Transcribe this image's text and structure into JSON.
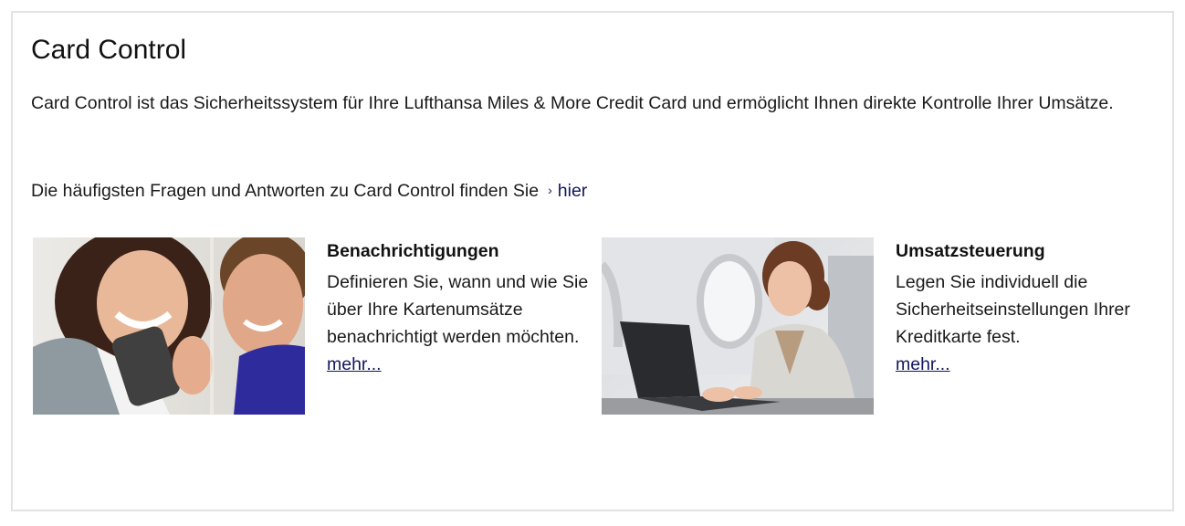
{
  "header": {
    "title": "Card Control"
  },
  "intro": "Card Control ist das Sicherheitssystem für Ihre Lufthansa Miles & More Credit Card und ermöglicht Ihnen direkte Kontrolle Ihrer Umsätze.",
  "faq": {
    "text": "Die häufigsten Fragen und Antworten zu Card Control finden Sie",
    "chevron": "›",
    "link_label": "hier"
  },
  "features": [
    {
      "title": "Benachrichtigungen",
      "text": "Definieren Sie, wann und wie Sie über Ihre Kartenumsätze benachrichtigt werden möchten.",
      "link_label": "mehr...",
      "image": "couple-with-smartphone-photo"
    },
    {
      "title": "Umsatzsteuerung",
      "text": "Legen Sie individuell die Sicherheitseinstellungen Ihrer Kreditkarte fest.",
      "link_label": "mehr...",
      "image": "woman-with-laptop-on-plane-photo"
    }
  ],
  "colors": {
    "link": "#12175e",
    "border": "#e3e3e3",
    "text": "#1a1a1a"
  }
}
